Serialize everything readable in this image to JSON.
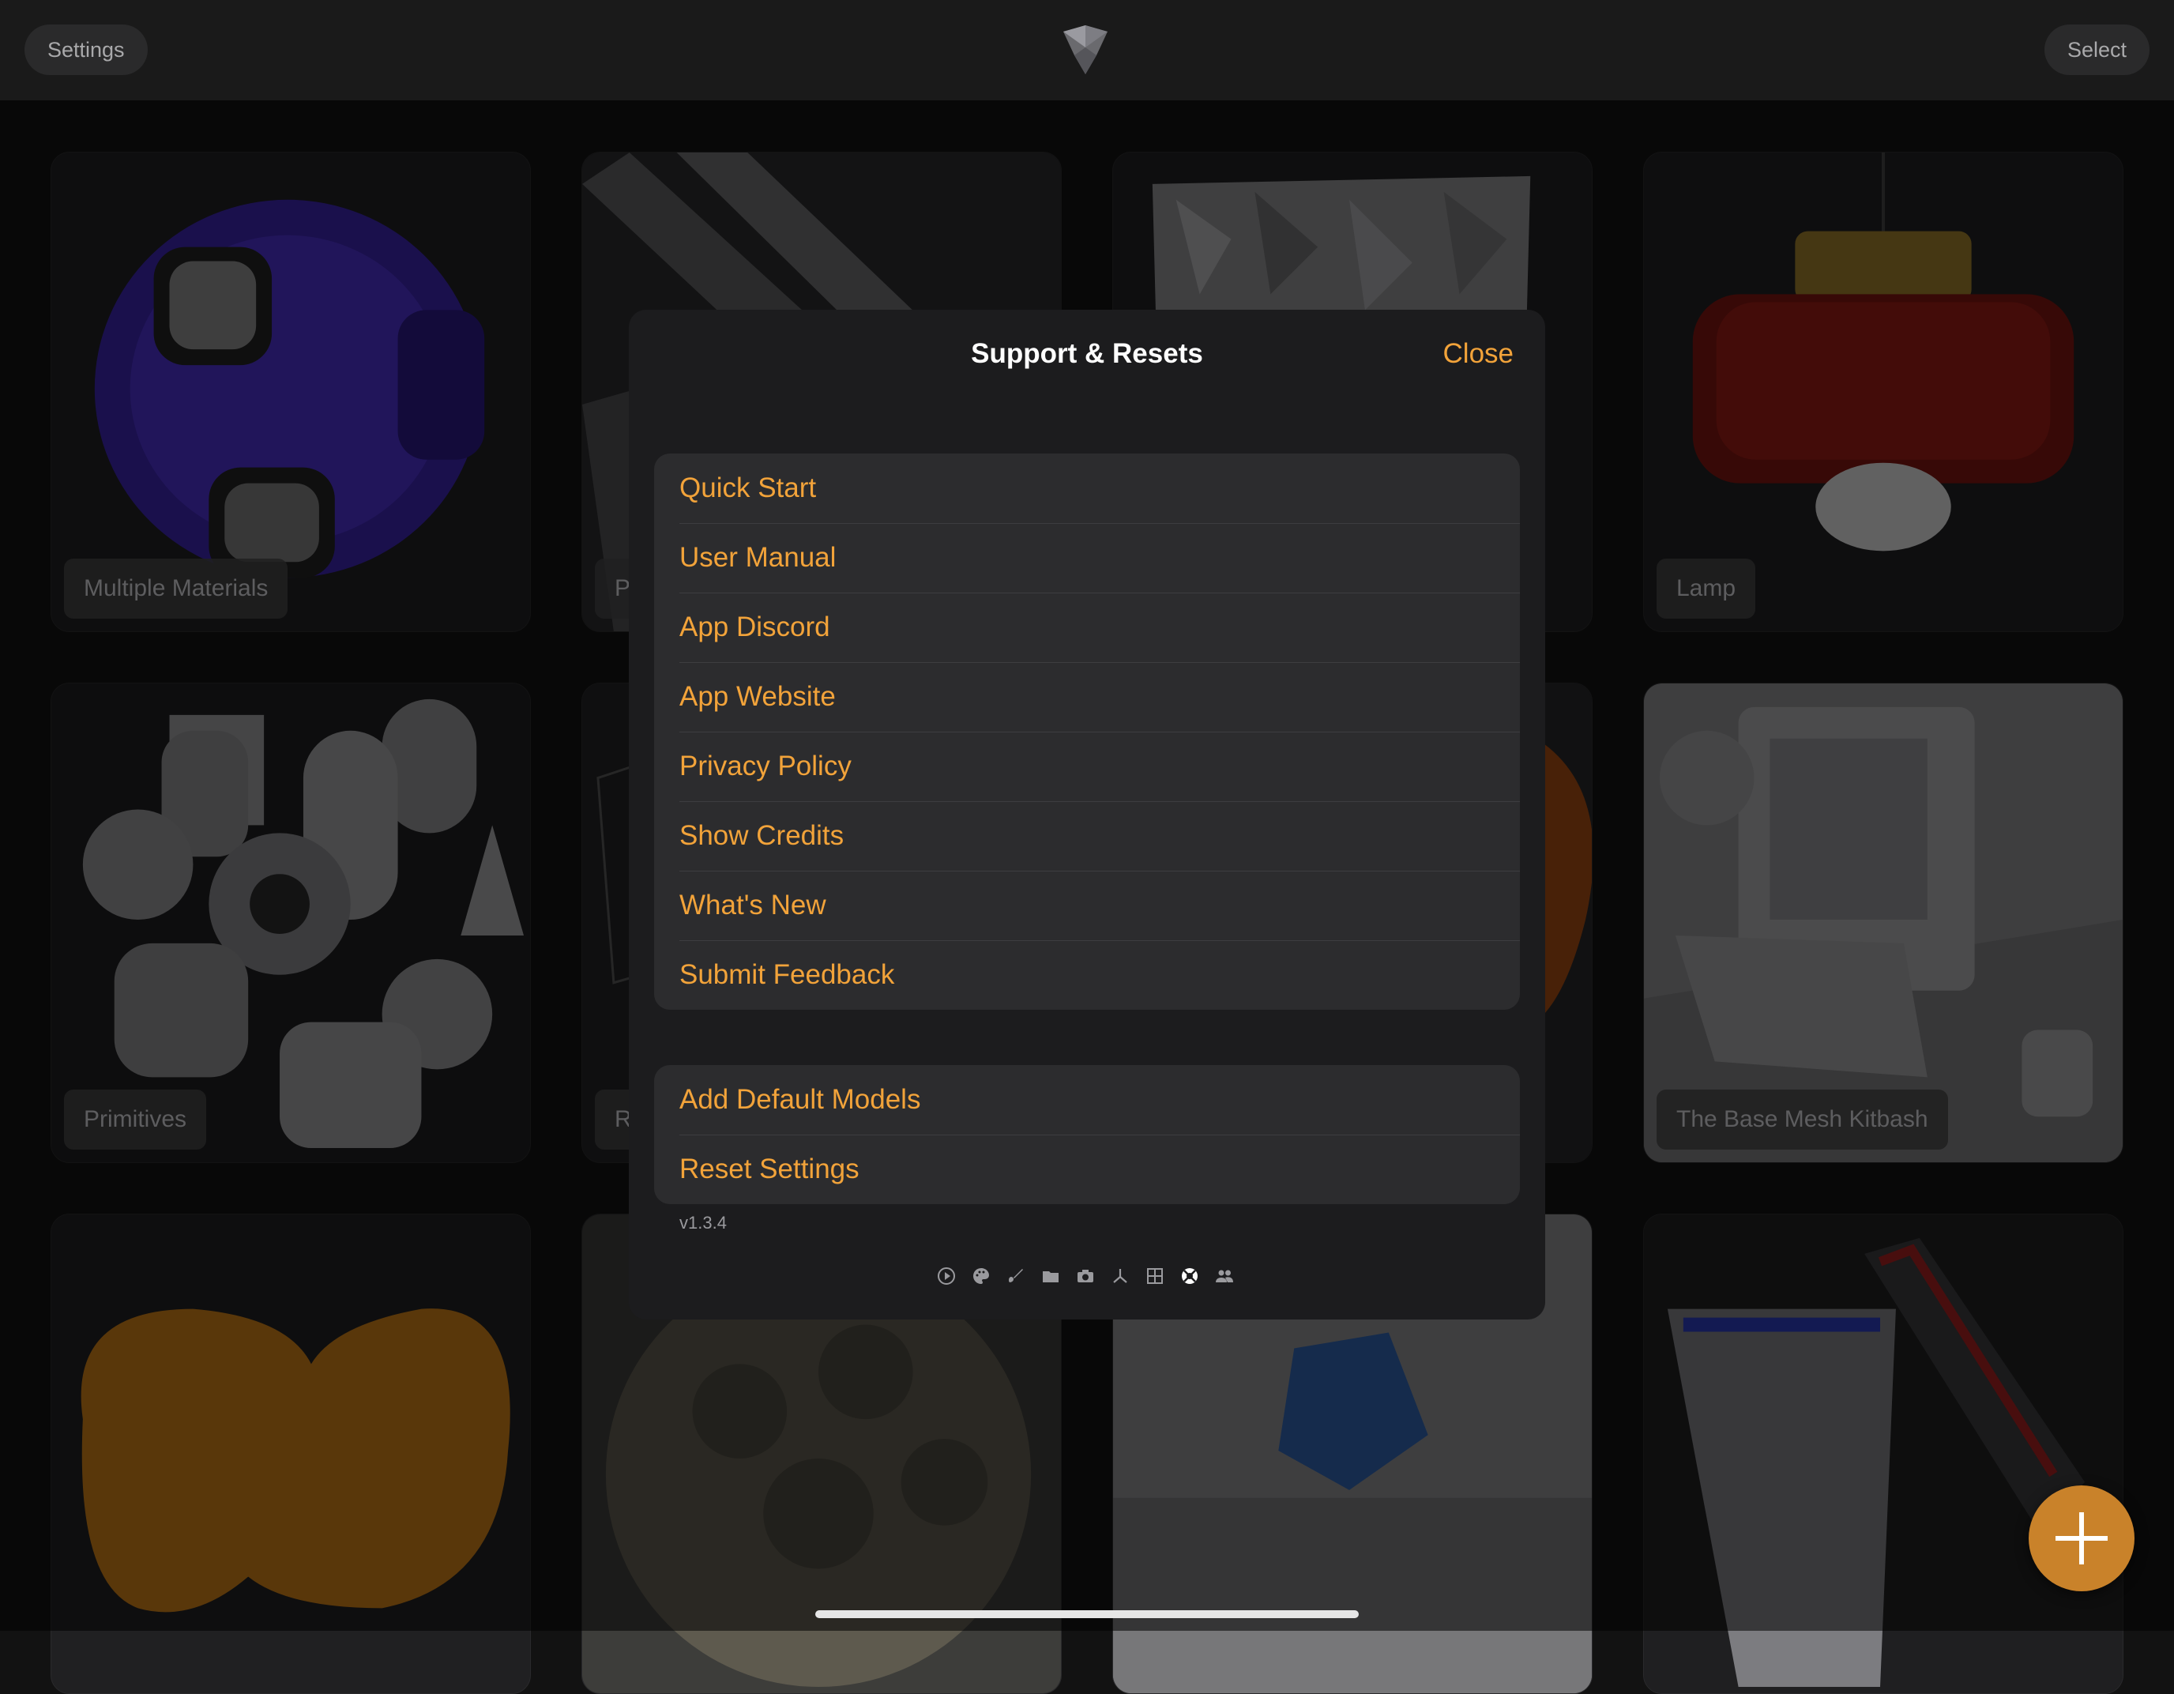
{
  "topbar": {
    "settings_label": "Settings",
    "select_label": "Select",
    "logo_icon": "app-logo-icon"
  },
  "grid": {
    "cards": [
      {
        "label": "Multiple Materials"
      },
      {
        "label": "P"
      },
      {
        "label": ""
      },
      {
        "label": "Lamp"
      },
      {
        "label": "Primitives"
      },
      {
        "label": "R"
      },
      {
        "label": ""
      },
      {
        "label": "The Base Mesh Kitbash"
      },
      {
        "label": ""
      },
      {
        "label": ""
      },
      {
        "label": ""
      },
      {
        "label": ""
      }
    ]
  },
  "modal": {
    "title": "Support & Resets",
    "close_label": "Close",
    "support_items": [
      "Quick Start",
      "User Manual",
      "App Discord",
      "App Website",
      "Privacy Policy",
      "Show Credits",
      "What's New",
      "Submit Feedback"
    ],
    "reset_items": [
      "Add Default Models",
      "Reset Settings"
    ],
    "version": "v1.3.4",
    "toolbar_icons": [
      "play-icon",
      "palette-icon",
      "brush-icon",
      "folder-icon",
      "camera-icon",
      "axes-icon",
      "grid-icon",
      "help-circle-icon",
      "people-icon"
    ]
  },
  "colors": {
    "accent": "#f2a33a",
    "fab": "#c9822a",
    "background": "#121212",
    "panel": "#1c1c1e"
  },
  "fab": {
    "icon": "plus-icon"
  }
}
